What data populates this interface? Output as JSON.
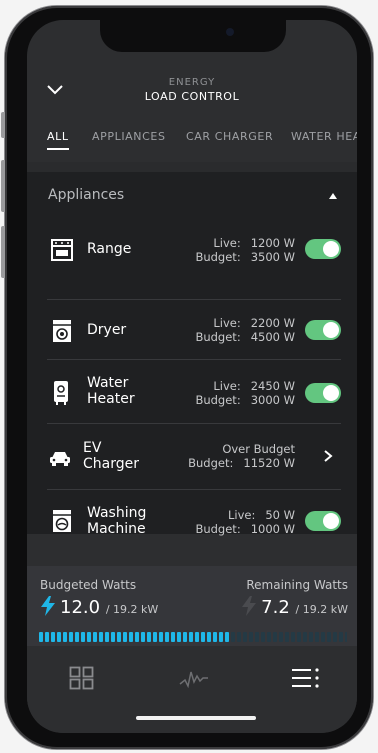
{
  "header": {
    "supertitle": "ENERGY",
    "title": "LOAD CONTROL"
  },
  "tabs": [
    {
      "label": "ALL",
      "active": true
    },
    {
      "label": "APPLIANCES",
      "active": false
    },
    {
      "label": "CAR CHARGER",
      "active": false
    },
    {
      "label": "WATER HEA",
      "active": false
    }
  ],
  "section": {
    "title": "Appliances"
  },
  "labels": {
    "live": "Live:",
    "budget": "Budget:"
  },
  "devices": [
    {
      "name_line1": "Range",
      "name_line2": "",
      "icon": "range-icon",
      "live": "1200 W",
      "budget": "3500 W",
      "enabled": true
    },
    {
      "name_line1": "Dryer",
      "name_line2": "",
      "icon": "dryer-icon",
      "live": "2200 W",
      "budget": "4500 W",
      "enabled": true
    },
    {
      "name_line1": "Water",
      "name_line2": "Heater",
      "icon": "water-heater-icon",
      "live": "2450 W",
      "budget": "3000 W",
      "enabled": true
    },
    {
      "name_line1": "EV",
      "name_line2": "Charger",
      "icon": "car-icon",
      "status": "Over Budget",
      "budget": "11520 W",
      "enabled": null
    },
    {
      "name_line1": "Washing",
      "name_line2": "Machine",
      "icon": "washing-machine-icon",
      "live": "50 W",
      "budget": "1000 W",
      "enabled": true
    }
  ],
  "summary": {
    "budgeted_label": "Budgeted Watts",
    "budgeted_value": "12.0",
    "budgeted_of": "/ 19.2 kW",
    "remaining_label": "Remaining Watts",
    "remaining_value": "7.2",
    "remaining_of": "/ 19.2 kW",
    "meter_fraction": 0.62
  },
  "colors": {
    "accent": "#1fb7e8",
    "toggle_on": "#63c680",
    "panel": "#1f2022",
    "background": "#2d2e30"
  },
  "tabbar": [
    "dashboard-icon",
    "activity-icon",
    "menu-icon"
  ]
}
